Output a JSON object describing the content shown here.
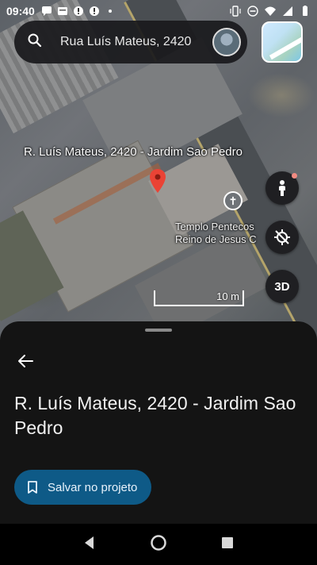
{
  "status_bar": {
    "time": "09:40",
    "icons_left": [
      "chat-icon",
      "message-icon",
      "alert-icon",
      "alert-icon"
    ],
    "icons_right": [
      "vibrate-icon",
      "do-not-disturb-icon",
      "wifi-icon",
      "signal-icon",
      "battery-icon"
    ]
  },
  "search": {
    "value": "Rua Luís Mateus, 2420"
  },
  "map": {
    "place_label": "R. Luís Mateus, 2420 - Jardim Sao Pedro",
    "poi_label_line1": "Templo Pentecos",
    "poi_label_line2": "Reino de Jesus C",
    "threed_label": "3D",
    "scale_label": "10 m"
  },
  "sheet": {
    "title": "R. Luís Mateus, 2420 - Jardim Sao Pedro",
    "save_label": "Salvar no projeto"
  },
  "colors": {
    "save_button_bg": "#0e5a87",
    "pin": "#ea4335",
    "sheet_bg": "#141414"
  }
}
